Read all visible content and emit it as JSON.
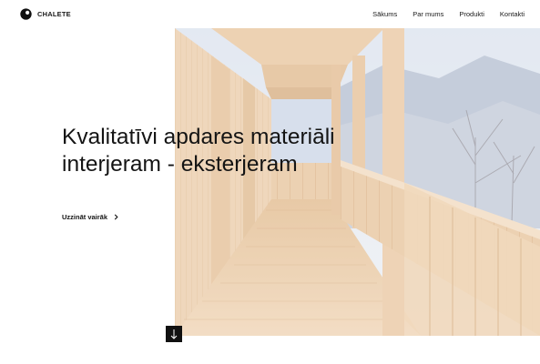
{
  "brand": {
    "name": "CHALETE",
    "logo_icon": "chalete-logo-icon"
  },
  "nav": {
    "items": [
      {
        "label": "Sākums"
      },
      {
        "label": "Par mums"
      },
      {
        "label": "Produkti"
      },
      {
        "label": "Kontakti"
      }
    ]
  },
  "hero": {
    "headline_line1": "Kvalitatīvi apdares materiāli",
    "headline_line2": "interjeram - eksterjeram",
    "cta_label": "Uzzināt vairāk",
    "cta_icon": "chevron-right-icon",
    "scroll_icon": "arrow-down-icon",
    "image": "wooden-balcony-photo"
  },
  "colors": {
    "text": "#141414",
    "scroll_button": "#111111",
    "wood": "#e6c29c",
    "sky": "#c9d6ea"
  }
}
